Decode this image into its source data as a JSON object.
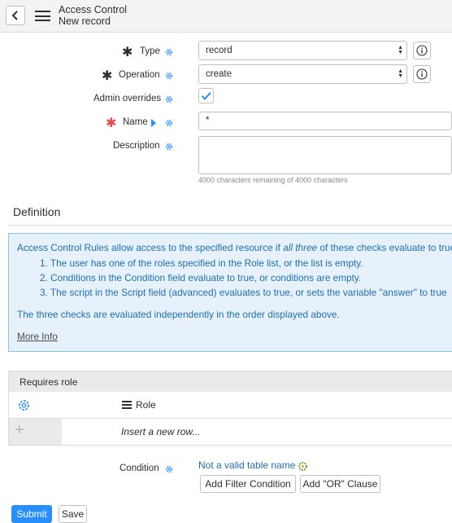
{
  "header": {
    "title": "Access Control",
    "subtitle": "New record"
  },
  "form": {
    "type": {
      "label": "Type",
      "value": "record"
    },
    "operation": {
      "label": "Operation",
      "value": "create"
    },
    "admin_overrides": {
      "label": "Admin overrides",
      "checked": true
    },
    "name": {
      "label": "Name",
      "value": "*"
    },
    "description": {
      "label": "Description",
      "value": "",
      "hint": "4000 characters remaining of 4000 characters"
    }
  },
  "definition": {
    "title": "Definition",
    "intro_pre": "Access Control Rules allow access to the specified resource if ",
    "intro_em": "all three",
    "intro_post": " of these checks evaluate to true",
    "items": [
      "1. The user has one of the roles specified in the Role list, or the list is empty.",
      "2. Conditions in the Condition field evaluate to true, or conditions are empty.",
      "3. The script in the Script field (advanced) evaluates to true, or sets the variable \"answer\" to true"
    ],
    "note": "The three checks are evaluated independently in the order displayed above.",
    "more_info": "More Info"
  },
  "requires_role": {
    "title": "Requires role",
    "column": "Role",
    "insert_placeholder": "Insert a new row..."
  },
  "condition": {
    "label": "Condition",
    "error_link": "Not a valid table name",
    "add_filter": "Add Filter Condition",
    "add_or": "Add \"OR\" Clause"
  },
  "actions": {
    "submit": "Submit",
    "save": "Save"
  },
  "colors": {
    "accent": "#278efc",
    "link": "#1f6fb2",
    "info_bg": "#e6f1fb",
    "required_red": "#e64a4a"
  }
}
